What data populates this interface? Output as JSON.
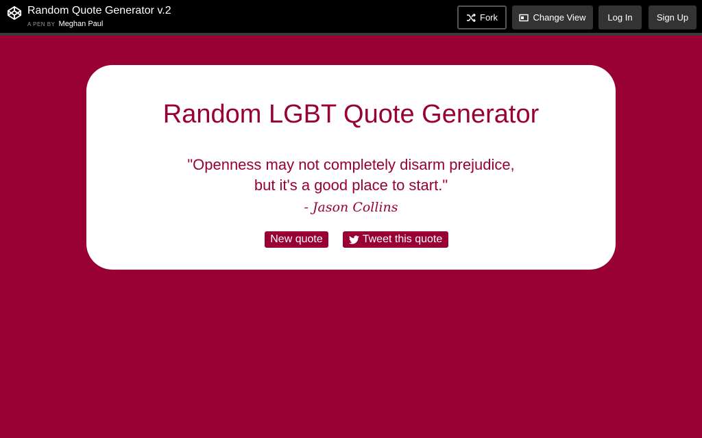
{
  "header": {
    "title": "Random Quote Generator v.2",
    "by_prefix": "A PEN BY",
    "author": "Meghan Paul",
    "logo_icon": "codepen-icon"
  },
  "actions": {
    "fork": "Fork",
    "change_view": "Change View",
    "log_in": "Log In",
    "sign_up": "Sign Up"
  },
  "app": {
    "heading": "Random LGBT Quote Generator",
    "quote": "\"Openness may not completely disarm prejudice, but it's a good place to start.\"",
    "author": "- Jason Collins",
    "new_quote": "New quote",
    "tweet": "Tweet this quote"
  },
  "colors": {
    "background": "#990033",
    "card": "#ffffff",
    "topbar": "#000000"
  }
}
